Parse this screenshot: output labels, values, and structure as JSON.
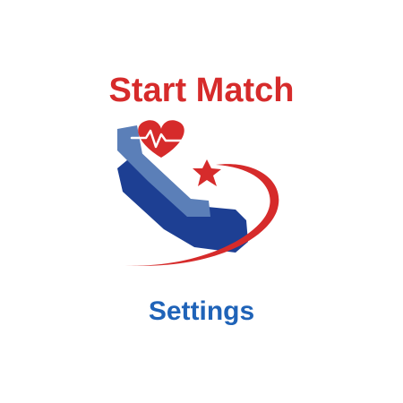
{
  "menu": {
    "start_label": "Start Match",
    "settings_label": "Settings"
  },
  "logo": {
    "icons": [
      "heart-pulse-icon",
      "star-icon",
      "swoosh-icon",
      "figure-icon"
    ]
  },
  "colors": {
    "red": "#d62b2b",
    "blue": "#1f63b8",
    "dark_blue": "#1d3f93",
    "light_blue": "#5b7fb8"
  }
}
